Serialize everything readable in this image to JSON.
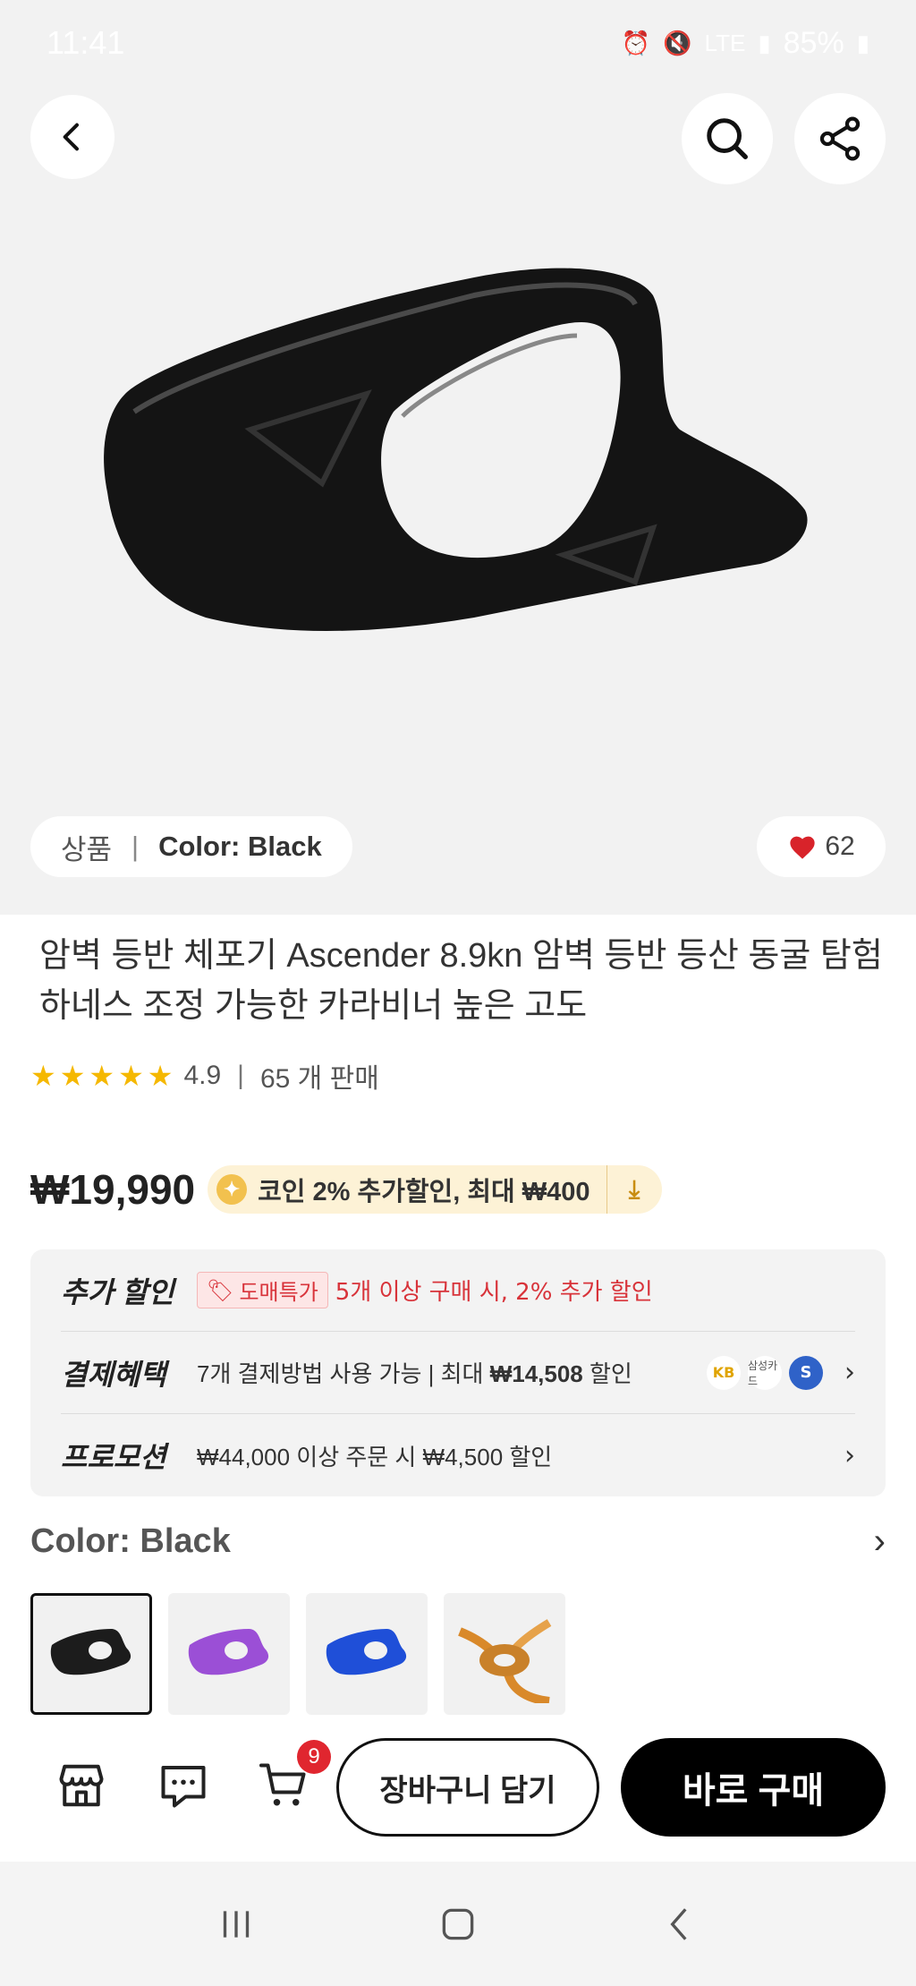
{
  "status_bar": {
    "time": "11:41",
    "battery": "85%",
    "icons": [
      "alarm-icon",
      "mute-icon",
      "lte-icon",
      "signal-icon",
      "battery-icon"
    ]
  },
  "product": {
    "image_badge": {
      "kind": "상품",
      "color": "Color: Black"
    },
    "likes": "62",
    "title": "암벽 등반 체포기 Ascender 8.9kn 암벽 등반 등산 동굴 탐험 하네스 조정 가능한 카라비너 높은 고도",
    "rating": "4.9",
    "sold": "65 개 판매",
    "price": "₩19,990",
    "coin_text": "코인 2% 추가할인, 최대 ₩400"
  },
  "benefits": {
    "extra": {
      "label": "추가 할인",
      "tag": "도매특가",
      "text": "5개 이상 구매 시, 2% 추가 할인"
    },
    "payment": {
      "label": "결제혜택",
      "text_prefix": "7개 결제방법 사용 가능 | 최대 ",
      "amount": "₩14,508",
      "text_suffix": " 할인",
      "card_kb": "KB",
      "card_samsung": "삼성카드",
      "card_shinhan": "S"
    },
    "promotion": {
      "label": "프로모션",
      "text": "₩44,000 이상 주문 시 ₩4,500 할인"
    }
  },
  "color_section": {
    "heading": "Color: Black",
    "options": [
      "Black",
      "Purple",
      "Blue",
      "Orange rope"
    ],
    "option_colors": [
      "#1c1c1c",
      "#9b4fd6",
      "#1f4fd8",
      "#d9892a"
    ]
  },
  "actions": {
    "cart_count": "9",
    "add_to_cart": "장바구니 담기",
    "buy_now": "바로 구매"
  }
}
